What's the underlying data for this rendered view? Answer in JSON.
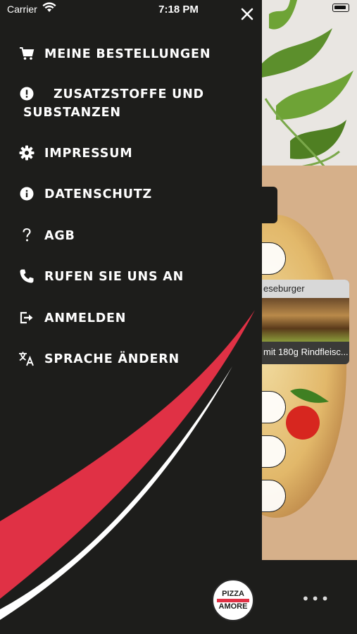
{
  "status_bar": {
    "carrier": "Carrier",
    "time": "7:18 PM"
  },
  "menu": {
    "items": [
      {
        "label": "MEINE BESTELLUNGEN",
        "icon": "cart-icon"
      },
      {
        "label": "ZUSATZSTOFFE UND SUBSTANZEN",
        "icon": "alert-icon"
      },
      {
        "label": "IMPRESSUM",
        "icon": "gear-icon"
      },
      {
        "label": "DATENSCHUTZ",
        "icon": "info-icon"
      },
      {
        "label": "AGB",
        "icon": "question-icon"
      },
      {
        "label": "RUFEN SIE UNS AN",
        "icon": "phone-icon"
      },
      {
        "label": "ANMELDEN",
        "icon": "login-icon"
      },
      {
        "label": "SPRACHE ÄNDERN",
        "icon": "translate-icon"
      }
    ]
  },
  "background": {
    "card_title": "eseburger",
    "card_desc": "mit 180g Rindfleisc...",
    "more": "•••"
  },
  "logo": {
    "top": "PIZZA",
    "bottom": "AMORE"
  },
  "colors": {
    "drawer": "#1d1d1b",
    "accent_red": "#e03145",
    "text": "#ffffff"
  }
}
